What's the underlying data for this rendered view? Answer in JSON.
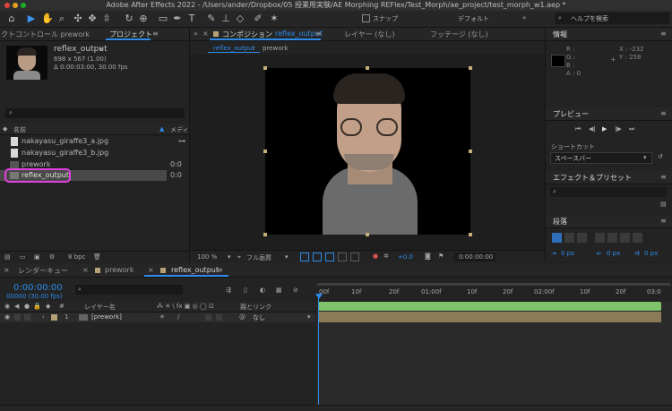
{
  "window_title": "Adobe After Effects 2022 - /Users/ander/Dropbox/05 授業用実験/AE Morphing REFlex/Test_Morph/ae_project/test_morph_w1.aep *",
  "toolbar": {
    "snap_label": "スナップ",
    "workspace_label": "デフォルト",
    "help_search_placeholder": "ヘルプを検索"
  },
  "project_panel": {
    "tab_effect_controls": "クトコントロール prework",
    "tab_project": "プロジェクト",
    "selected_name": "reflex_output",
    "selected_info1": "698 x 567 (1.00)",
    "selected_info2": "Δ 0:00:03:00, 30.00 fps",
    "col_name": "名前",
    "col_media": "メディ",
    "items": [
      {
        "name": "nakayasu_giraffe3_a.jpg",
        "extra": ""
      },
      {
        "name": "nakayasu_giraffe3_b.jpg",
        "extra": ""
      },
      {
        "name": "prework",
        "extra": "0:0"
      },
      {
        "name": "reflex_output",
        "extra": "0:0"
      }
    ],
    "bpc": "8 bpc"
  },
  "comp_panel": {
    "tab_label": "コンポジション",
    "tab_comp_name": "reflex_output",
    "layer_tab": "レイヤー (なし)",
    "footage_tab": "フッテージ (なし)",
    "breadcrumb1": "reflex_output",
    "breadcrumb2": "prework",
    "zoom": "100 %",
    "quality": "フル画質",
    "exposure": "+0.0",
    "timecode": "0:00:00:00"
  },
  "info_panel": {
    "title": "情報",
    "r": "R :",
    "g": "G :",
    "b": "B :",
    "a": "A :  0",
    "x": "X : -232",
    "y": "Y :  258"
  },
  "preview_panel": {
    "title": "プレビュー",
    "shortcut_label": "ショートカット",
    "shortcut_value": "スペースバー"
  },
  "effects_panel": {
    "title": "エフェクト＆プリセット"
  },
  "paragraph_panel": {
    "title": "段落",
    "px1": "0 px",
    "px2": "0 px",
    "px3": "0 px"
  },
  "timeline": {
    "tab_render": "レンダーキュー",
    "tab_prework": "prework",
    "tab_reflex": "reflex_output",
    "timecode": "0:00:00:00",
    "timecode_sub": "00000 (30.00 fps)",
    "col_layer_name": "レイヤー名",
    "col_parent": "親とリンク",
    "layer_num": "1",
    "layer_name": "[prework]",
    "parent_value": "なし",
    "ruler": [
      "00f",
      "10f",
      "20f",
      "01:00f",
      "10f",
      "20f",
      "02:00f",
      "10f",
      "20f",
      "03:0"
    ]
  },
  "colors": {
    "accent": "#2d8ceb",
    "highlight_box": "#e040e0",
    "layer_bar": "#8b7b57"
  }
}
